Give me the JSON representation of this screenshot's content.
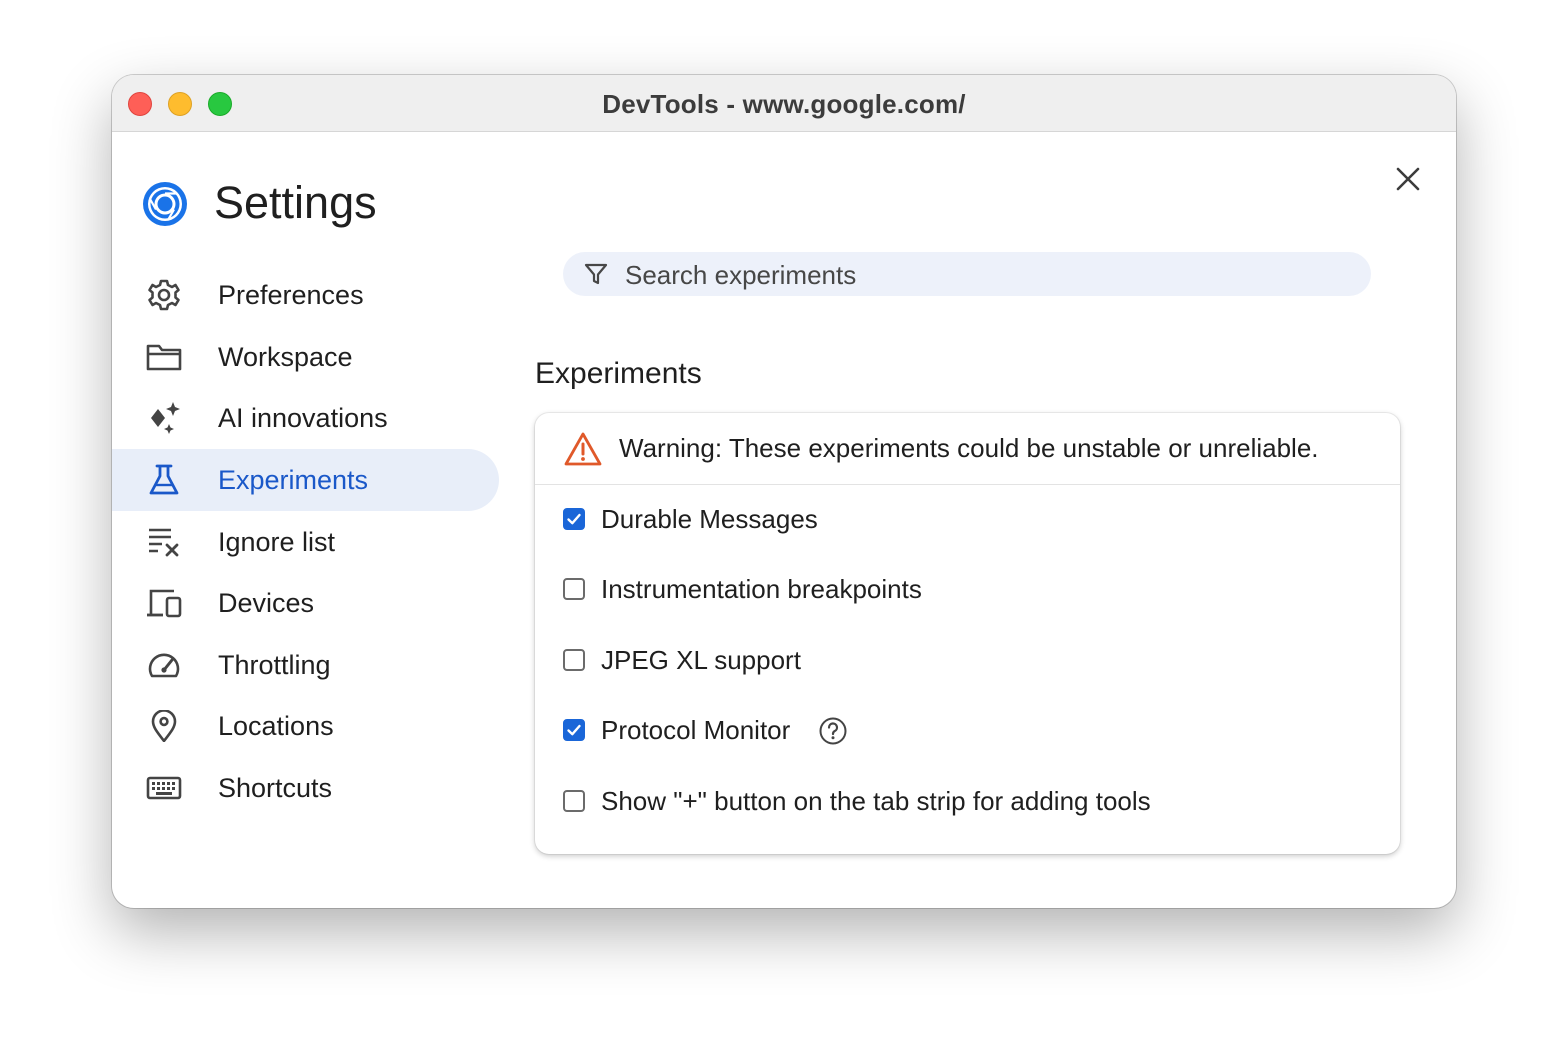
{
  "window": {
    "title": "DevTools - www.google.com/"
  },
  "settings": {
    "title": "Settings"
  },
  "nav": {
    "items": [
      {
        "label": "Preferences",
        "icon": "gear-icon",
        "active": false
      },
      {
        "label": "Workspace",
        "icon": "folder-icon",
        "active": false
      },
      {
        "label": "AI innovations",
        "icon": "sparkle-icon",
        "active": false
      },
      {
        "label": "Experiments",
        "icon": "flask-icon",
        "active": true
      },
      {
        "label": "Ignore list",
        "icon": "ignore-list-icon",
        "active": false
      },
      {
        "label": "Devices",
        "icon": "devices-icon",
        "active": false
      },
      {
        "label": "Throttling",
        "icon": "speedometer-icon",
        "active": false
      },
      {
        "label": "Locations",
        "icon": "location-pin-icon",
        "active": false
      },
      {
        "label": "Shortcuts",
        "icon": "keyboard-icon",
        "active": false
      }
    ]
  },
  "search": {
    "placeholder": "Search experiments",
    "icon": "filter-icon"
  },
  "experiments": {
    "title": "Experiments",
    "warning": "Warning: These experiments could be unstable or unreliable.",
    "items": [
      {
        "label": "Durable Messages",
        "checked": true,
        "help": false
      },
      {
        "label": "Instrumentation breakpoints",
        "checked": false,
        "help": false
      },
      {
        "label": "JPEG XL support",
        "checked": false,
        "help": false
      },
      {
        "label": "Protocol Monitor",
        "checked": true,
        "help": true
      },
      {
        "label": "Show \"+\" button on the tab strip for adding tools",
        "checked": false,
        "help": false
      }
    ]
  },
  "colors": {
    "accent": "#1a66d8",
    "active_nav_bg": "#e8eef9",
    "active_nav_text": "#1a58c9",
    "warning": "#e0592a"
  }
}
